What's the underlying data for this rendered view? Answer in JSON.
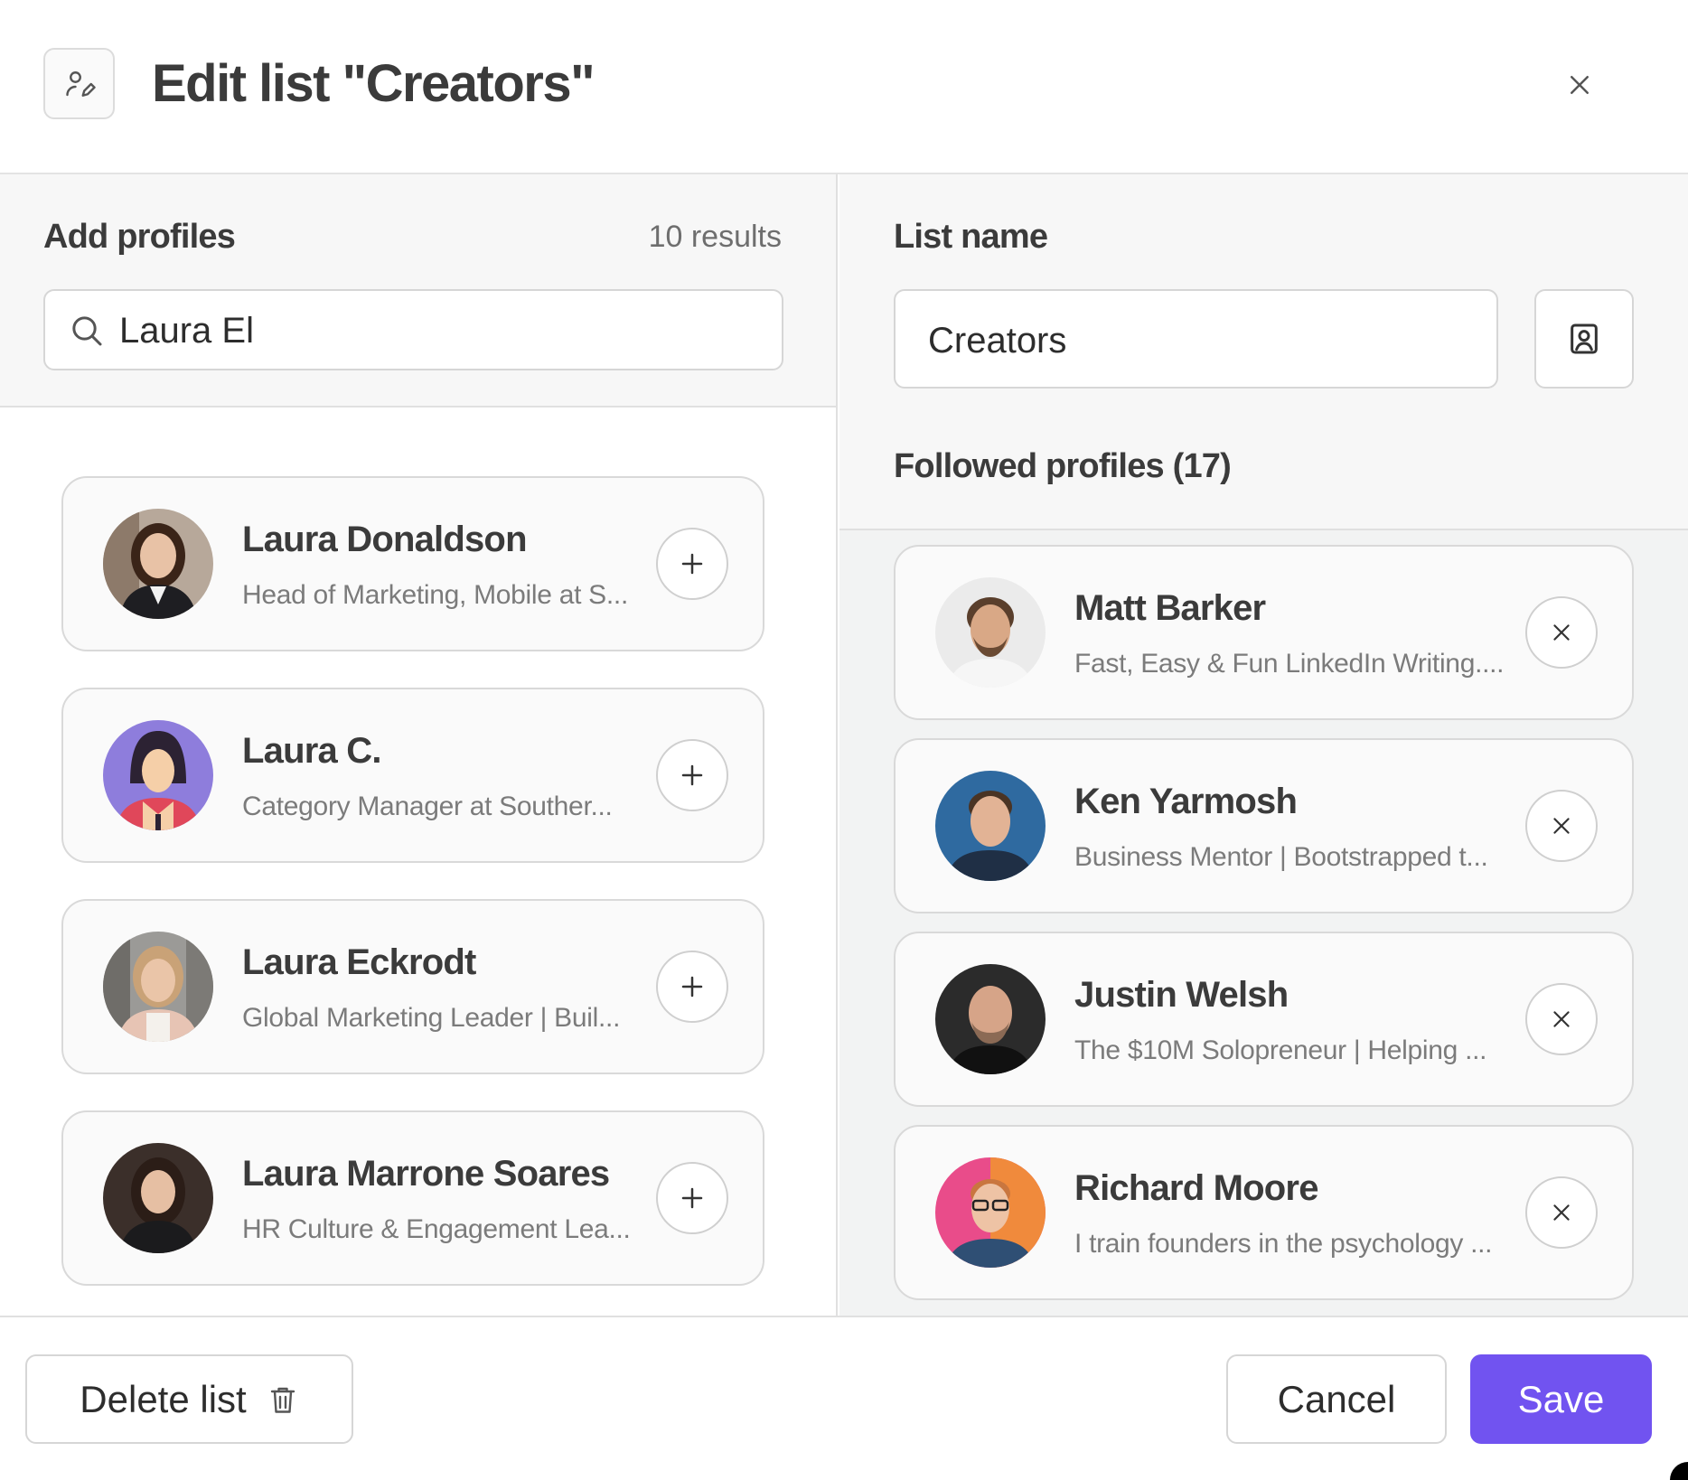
{
  "header": {
    "icon": "user-edit-icon",
    "title": "Edit list \"Creators\"",
    "close_icon": "close-icon"
  },
  "add_profiles": {
    "title": "Add profiles",
    "results": "10 results",
    "search_value": "Laura El",
    "search_icon": "search-icon",
    "items": [
      {
        "name": "Laura Donaldson",
        "subtitle": "Head of Marketing, Mobile at S...",
        "action_icon": "plus-icon"
      },
      {
        "name": "Laura C.",
        "subtitle": "Category Manager at Souther...",
        "action_icon": "plus-icon"
      },
      {
        "name": "Laura Eckrodt",
        "subtitle": "Global Marketing Leader | Buil...",
        "action_icon": "plus-icon"
      },
      {
        "name": "Laura Marrone Soares",
        "subtitle": "HR Culture & Engagement Lea...",
        "action_icon": "plus-icon"
      }
    ]
  },
  "list": {
    "label": "List name",
    "name_value": "Creators",
    "contact_icon": "contact-card-icon",
    "followed_title": "Followed profiles (17)",
    "items": [
      {
        "name": "Matt Barker",
        "subtitle": "Fast, Easy & Fun LinkedIn Writing....",
        "action_icon": "close-icon"
      },
      {
        "name": "Ken Yarmosh",
        "subtitle": "Business Mentor | Bootstrapped t...",
        "action_icon": "close-icon"
      },
      {
        "name": "Justin Welsh",
        "subtitle": "The $10M Solopreneur | Helping ...",
        "action_icon": "close-icon"
      },
      {
        "name": "Richard Moore",
        "subtitle": "I train founders in the psychology ...",
        "action_icon": "close-icon"
      }
    ]
  },
  "footer": {
    "delete_label": "Delete list",
    "delete_icon": "trash-icon",
    "cancel_label": "Cancel",
    "save_label": "Save"
  },
  "colors": {
    "accent": "#7153f0",
    "panel_bg": "#f7f7f7",
    "card_bg": "#fafafa",
    "text": "#3b3b3b",
    "muted": "#7b7b7b"
  }
}
